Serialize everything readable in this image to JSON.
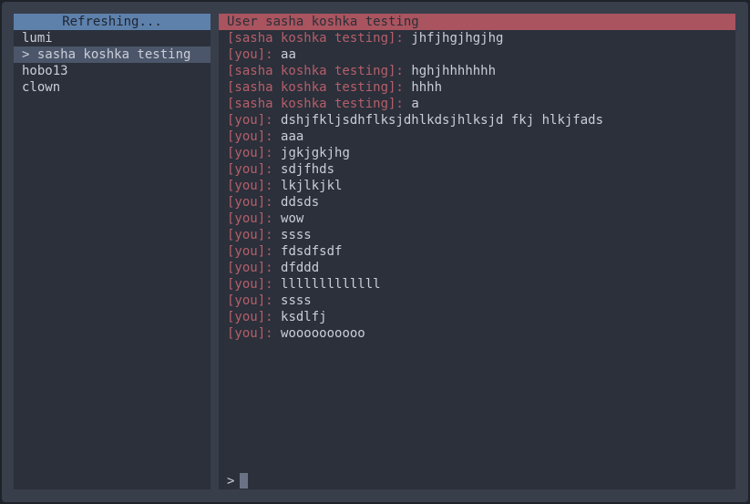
{
  "sidebar": {
    "header": "Refreshing...",
    "contacts": [
      {
        "label": "lumi"
      },
      {
        "label": "> sasha koshka testing"
      },
      {
        "label": "hobo13"
      },
      {
        "label": "clown"
      }
    ]
  },
  "chat": {
    "header": "User sasha koshka testing",
    "messages": [
      {
        "sender": "[sasha koshka testing]:",
        "text": "jhfjhgjhgjhg"
      },
      {
        "sender": "[you]:",
        "text": "aa"
      },
      {
        "sender": "[sasha koshka testing]:",
        "text": "hghjhhhhhhh"
      },
      {
        "sender": "[sasha koshka testing]:",
        "text": "hhhh"
      },
      {
        "sender": "[sasha koshka testing]:",
        "text": "a"
      },
      {
        "sender": "[you]:",
        "text": "dshjfkljsdhflksjdhlkdsjhlksjd fkj hlkjfads"
      },
      {
        "sender": "[you]:",
        "text": "aaa"
      },
      {
        "sender": "[you]:",
        "text": "jgkjgkjhg"
      },
      {
        "sender": "[you]:",
        "text": "sdjfhds"
      },
      {
        "sender": "[you]:",
        "text": "lkjlkjkl"
      },
      {
        "sender": "[you]:",
        "text": "ddsds"
      },
      {
        "sender": "[you]:",
        "text": "wow"
      },
      {
        "sender": "[you]:",
        "text": "ssss"
      },
      {
        "sender": "[you]:",
        "text": "fdsdfsdf"
      },
      {
        "sender": "[you]:",
        "text": "dfddd"
      },
      {
        "sender": "[you]:",
        "text": "lllllllllllll"
      },
      {
        "sender": "[you]:",
        "text": "ssss"
      },
      {
        "sender": "[you]:",
        "text": "ksdlfj"
      },
      {
        "sender": "[you]:",
        "text": "woooooooooo"
      }
    ],
    "prompt": ">",
    "input_value": ""
  }
}
